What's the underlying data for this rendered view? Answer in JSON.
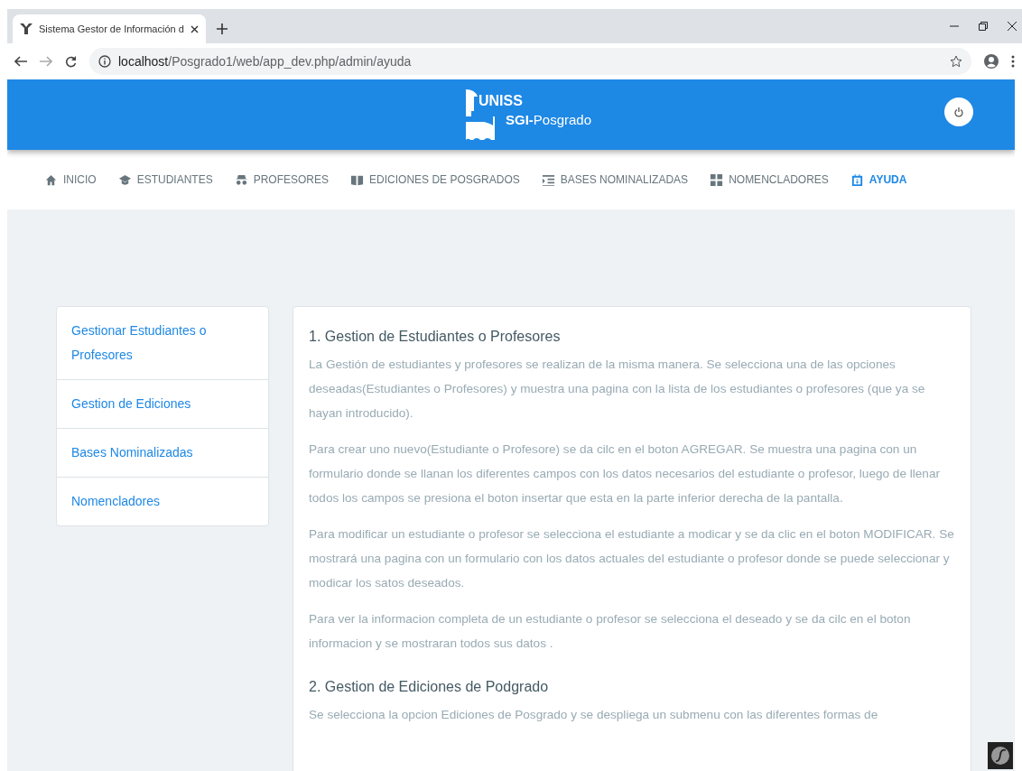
{
  "browser": {
    "tab_title": "Sistema Gestor de Información d",
    "url_host": "localhost",
    "url_path": "/Posgrado1/web/app_dev.php/admin/ayuda"
  },
  "header": {
    "logo_text": "UNISS",
    "brand_bold": "SGI-",
    "brand_rest": "Posgrado"
  },
  "nav": [
    {
      "label": "INICIO",
      "selected": false
    },
    {
      "label": "ESTUDIANTES",
      "selected": false
    },
    {
      "label": "PROFESORES",
      "selected": false
    },
    {
      "label": "EDICIONES DE POSGRADOS",
      "selected": false
    },
    {
      "label": "BASES NOMINALIZADAS",
      "selected": false
    },
    {
      "label": "NOMENCLADORES",
      "selected": false
    },
    {
      "label": "AYUDA",
      "selected": true
    }
  ],
  "sidebar": {
    "items": [
      "Gestionar Estudiantes o Profesores",
      "Gestion de Ediciones",
      "Bases Nominalizadas",
      "Nomencladores"
    ]
  },
  "content": {
    "sections": [
      {
        "title": "1. Gestion de Estudiantes o Profesores",
        "paragraphs": [
          "La Gestión de estudiantes y profesores se realizan de la misma manera. Se selecciona una de las opciones deseadas(Estudiantes o Profesores) y muestra una pagina con la lista de los estudiantes o profesores (que ya se hayan introducido).",
          "Para crear uno nuevo(Estudiante o Profesore) se da cilc en el boton AGREGAR. Se muestra una pagina con un formulario donde se llanan los diferentes campos con los datos necesarios del estudiante o profesor, luego de llenar todos los campos se presiona el boton insertar que esta en la parte inferior derecha de la pantalla.",
          "Para modificar un estudiante o profesor se selecciona el estudiante a modicar y se da clic en el boton MODIFICAR. Se mostrará una pagina con un formulario con los datos actuales del estudiante o profesor donde se puede seleccionar y modicar los satos deseados.",
          "Para ver la informacion completa de un estudiante o profesor se selecciona el deseado y se da cilc en el boton informacion y se mostraran todos sus datos ."
        ]
      },
      {
        "title": "2. Gestion de Ediciones de Podgrado",
        "paragraphs": [
          "Se selecciona la opcion Ediciones de Posgrado y se despliega un submenu con las diferentes formas de"
        ]
      }
    ]
  }
}
